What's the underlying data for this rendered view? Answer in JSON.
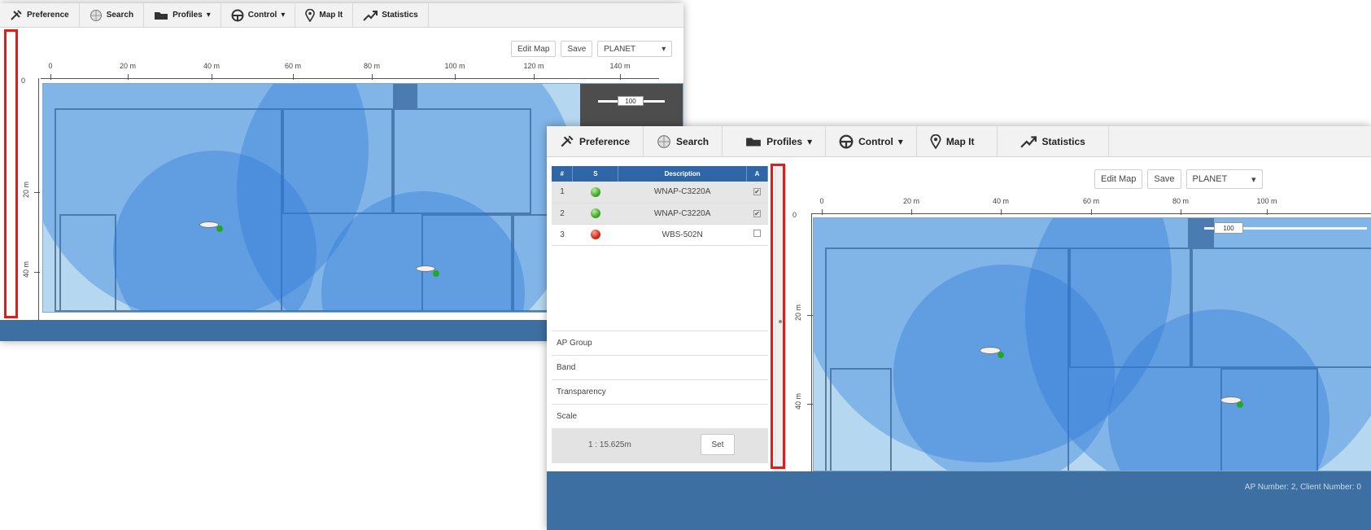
{
  "toolbar": {
    "preference": "Preference",
    "search": "Search",
    "profiles": "Profiles",
    "control": "Control",
    "map_it": "Map It",
    "statistics": "Statistics"
  },
  "map_controls": {
    "edit_map": "Edit Map",
    "save": "Save",
    "site_select": "PLANET"
  },
  "window_a": {
    "ruler_x": [
      "0",
      "20 m",
      "40 m",
      "60 m",
      "80 m",
      "100 m",
      "120 m",
      "140 m"
    ],
    "ruler_y": [
      "0",
      "20 m",
      "40 m"
    ],
    "zoom_value": "100"
  },
  "window_b": {
    "ruler_x": [
      "0",
      "20 m",
      "40 m",
      "60 m",
      "80 m",
      "100 m"
    ],
    "ruler_y": [
      "0",
      "20 m",
      "40 m"
    ],
    "zoom_value": "100",
    "table": {
      "headers": [
        "#",
        "S",
        "Description",
        "A"
      ],
      "rows": [
        {
          "index": "1",
          "status": "green",
          "description": "WNAP-C3220A",
          "checked": "✔"
        },
        {
          "index": "2",
          "status": "green",
          "description": "WNAP-C3220A",
          "checked": "✔"
        },
        {
          "index": "3",
          "status": "red",
          "description": "WBS-502N",
          "checked": ""
        }
      ]
    },
    "options": {
      "ap_group": "AP Group",
      "band": "Band",
      "transparency": "Transparency",
      "scale": "Scale"
    },
    "scale_value": "1 : 15.625m",
    "set_button": "Set",
    "footer_status": "AP Number: 2, Client Number: 0"
  },
  "colors": {
    "toolbar_bg": "#f2f2f2",
    "table_header": "#2f66a6",
    "footer": "#3d6fa3",
    "highlight": "#e41b1b",
    "arrow": "#4d8ed8",
    "coverage": "#2d78d7"
  },
  "icons": {
    "preference": "tools-icon",
    "search": "globe-search-icon",
    "profiles": "folder-icon",
    "control": "steering-wheel-icon",
    "map_it": "map-pin-icon",
    "statistics": "trend-arrow-icon"
  }
}
